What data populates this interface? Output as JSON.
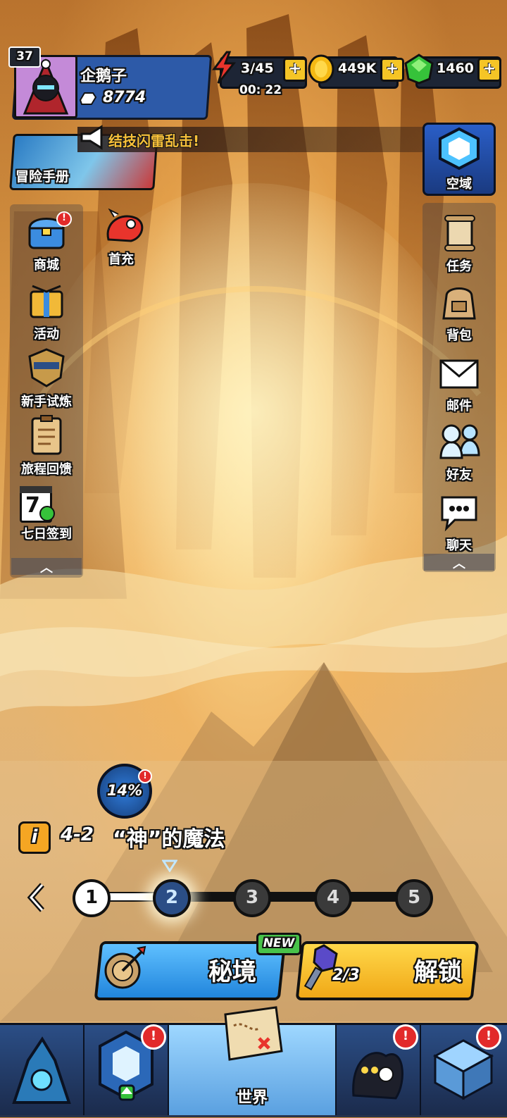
{
  "player": {
    "level": "37",
    "name": "企鹅子",
    "power": "8774"
  },
  "resources": {
    "energy": "3/45",
    "energy_timer": "00: 22",
    "gold": "449K",
    "gems": "1460"
  },
  "top": {
    "handbook_label": "冒险手册",
    "announcement": "结技闪雷乱击!",
    "airspace_label": "空域"
  },
  "left_menu": [
    {
      "label": "商城",
      "icon": "treasure-chest-icon"
    },
    {
      "label": "活动",
      "icon": "gift-crate-icon"
    },
    {
      "label": "新手试炼",
      "icon": "shield-trial-icon"
    },
    {
      "label": "旅程回馈",
      "icon": "clipboard-icon"
    },
    {
      "label": "七日签到",
      "icon": "calendar-icon",
      "day": "7"
    }
  ],
  "first_recharge_label": "首充",
  "right_menu": [
    {
      "label": "任务",
      "icon": "scroll-icon"
    },
    {
      "label": "背包",
      "icon": "backpack-icon"
    },
    {
      "label": "邮件",
      "icon": "mail-icon"
    },
    {
      "label": "好友",
      "icon": "friends-icon"
    },
    {
      "label": "聊天",
      "icon": "chat-icon"
    }
  ],
  "collapse_glyph": "︿",
  "progress": {
    "percent": "14%"
  },
  "stage": {
    "info_icon": "i",
    "code": "4-2",
    "title": "“神”的魔法"
  },
  "steps": [
    "1",
    "2",
    "3",
    "4",
    "5"
  ],
  "current_step": 2,
  "actions": {
    "secret_label": "秘境",
    "new_tag": "NEW",
    "unlock_label": "解锁",
    "unlock_count": "2/3"
  },
  "nav": {
    "world_label": "世界"
  },
  "colors": {
    "accent_blue": "#2d8ee0",
    "accent_yellow": "#f5c526",
    "badge_red": "#e22a2a"
  }
}
